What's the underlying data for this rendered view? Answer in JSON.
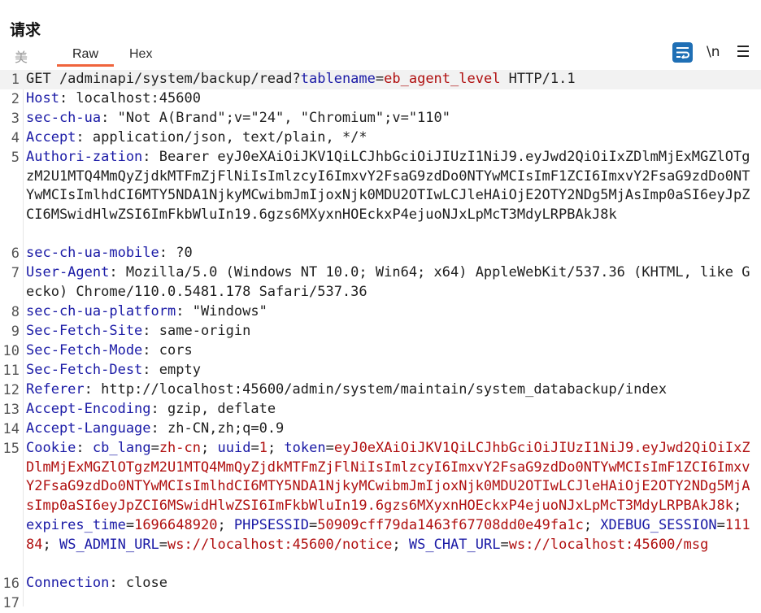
{
  "panel": {
    "title": "请求"
  },
  "tabs": {
    "pretty": "美",
    "raw": "Raw",
    "hex": "Hex"
  },
  "toolbar": {
    "newline_label": "\\n"
  },
  "colors": {
    "accent": "#f0643c",
    "button_blue": "#1f6fb5",
    "key": "#1a1aa6",
    "value": "#b01010"
  },
  "icons": {
    "wrap": "wrap-lines-icon",
    "menu": "hamburger-menu-icon"
  },
  "lines": [
    {
      "n": "1",
      "method": "GET /adminapi/system/backup/read?",
      "param_key": "tablename",
      "eq": "=",
      "param_val": "eb_agent_level",
      "proto": " HTTP/1.1"
    },
    {
      "n": "2",
      "key": "Host",
      "value": ": localhost:45600"
    },
    {
      "n": "3",
      "key": "sec-ch-ua",
      "value": ": \"Not A(Brand\";v=\"24\", \"Chromium\";v=\"110\""
    },
    {
      "n": "4",
      "key": "Accept",
      "value": ": application/json, text/plain, */*"
    },
    {
      "n": "5",
      "key": "Authori-zation",
      "value": ": Bearer eyJ0eXAiOiJKV1QiLCJhbGciOiJIUzI1NiJ9.eyJwd2QiOiIxZDlmMjExMGZlOTgzM2U1MTQ4MmQyZjdkMTFmZjFlNiIsImlzcyI6ImxvY2FsaG9zdDo0NTYwMCIsImF1ZCI6ImxvY2FsaG9zdDo0NTYwMCIsImlhdCI6MTY5NDA1NjkyMCwibmJmIjoxNjk0MDU2OTIwLCJleHAiOjE2OTY2NDg5MjAsImp0aSI6eyJpZCI6MSwidHlwZSI6ImFkbWluIn19.6gzs6MXyxnHOEckxP4ejuoNJxLpMcT3MdyLRPBAkJ8k"
    },
    {
      "n": "6",
      "key": "sec-ch-ua-mobile",
      "value": ": ?0"
    },
    {
      "n": "7",
      "key": "User-Agent",
      "value": ": Mozilla/5.0 (Windows NT 10.0; Win64; x64) AppleWebKit/537.36 (KHTML, like Gecko) Chrome/110.0.5481.178 Safari/537.36"
    },
    {
      "n": "8",
      "key": "sec-ch-ua-platform",
      "value": ": \"Windows\""
    },
    {
      "n": "9",
      "key": "Sec-Fetch-Site",
      "value": ": same-origin"
    },
    {
      "n": "10",
      "key": "Sec-Fetch-Mode",
      "value": ": cors"
    },
    {
      "n": "11",
      "key": "Sec-Fetch-Dest",
      "value": ": empty"
    },
    {
      "n": "12",
      "key": "Referer",
      "value": ": http://localhost:45600/admin/system/maintain/system_databackup/index"
    },
    {
      "n": "13",
      "key": "Accept-Encoding",
      "value": ": gzip, deflate"
    },
    {
      "n": "14",
      "key": "Accept-Language",
      "value": ": zh-CN,zh;q=0.9"
    },
    {
      "n": "15",
      "key": "Cookie",
      "value": ": ",
      "cookies": [
        {
          "name": "cb_lang",
          "val": "zh-cn"
        },
        {
          "name": "uuid",
          "val": "1"
        },
        {
          "name": "token",
          "val": "eyJ0eXAiOiJKV1QiLCJhbGciOiJIUzI1NiJ9.eyJwd2QiOiIxZDlmMjExMGZlOTgzM2U1MTQ4MmQyZjdkMTFmZjFlNiIsImlzcyI6ImxvY2FsaG9zdDo0NTYwMCIsImF1ZCI6ImxvY2FsaG9zdDo0NTYwMCIsImlhdCI6MTY5NDA1NjkyMCwibmJmIjoxNjk0MDU2OTIwLCJleHAiOjE2OTY2NDg5MjAsImp0aSI6eyJpZCI6MSwidHlwZSI6ImFkbWluIn19.6gzs6MXyxnHOEckxP4ejuoNJxLpMcT3MdyLRPBAkJ8k"
        },
        {
          "name": "expires_time",
          "val": "1696648920"
        },
        {
          "name": "PHPSESSID",
          "val": "50909cff79da1463f67708dd0e49fa1c"
        },
        {
          "name": "XDEBUG_SESSION",
          "val": "11184"
        },
        {
          "name": "WS_ADMIN_URL",
          "val": "ws://localhost:45600/notice"
        },
        {
          "name": "WS_CHAT_URL",
          "val": "ws://localhost:45600/msg"
        }
      ]
    },
    {
      "n": "16",
      "key": "Connection",
      "value": ": close"
    },
    {
      "n": "17",
      "key": "",
      "value": ""
    }
  ]
}
